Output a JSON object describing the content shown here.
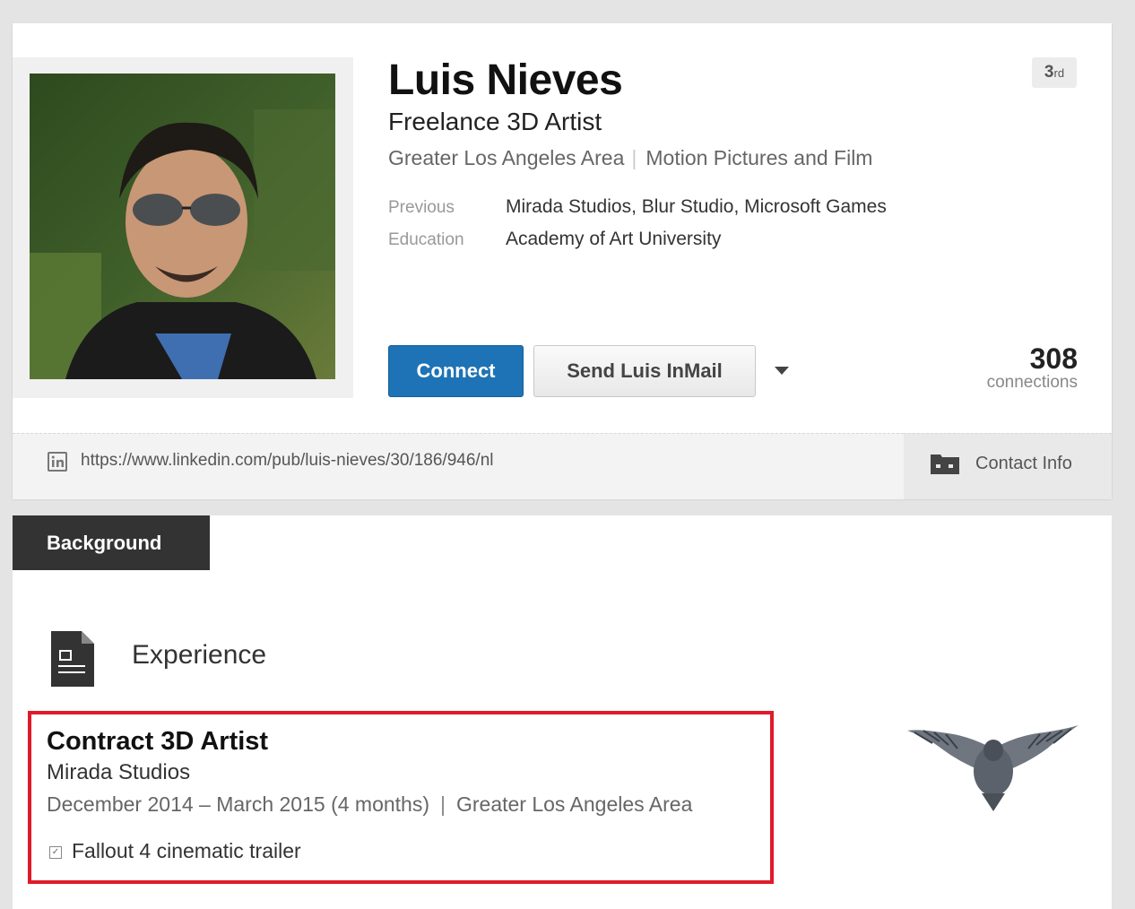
{
  "profile": {
    "name": "Luis Nieves",
    "headline": "Freelance 3D Artist",
    "location": "Greater Los Angeles Area",
    "industry": "Motion Pictures and Film",
    "degree": "3",
    "degree_suffix": "rd",
    "previous_label": "Previous",
    "previous_value": "Mirada Studios, Blur Studio, Microsoft Games",
    "education_label": "Education",
    "education_value": "Academy of Art University"
  },
  "actions": {
    "connect_label": "Connect",
    "inmail_label": "Send Luis InMail"
  },
  "connections": {
    "count": "308",
    "label": "connections"
  },
  "public_profile": {
    "url": "https://www.linkedin.com/pub/luis-nieves/30/186/946/nl",
    "contact_label": "Contact Info"
  },
  "background": {
    "tab_label": "Background",
    "section_title": "Experience"
  },
  "experience": [
    {
      "title": "Contract 3D Artist",
      "company": "Mirada Studios",
      "dates": "December 2014 – March 2015 (4 months)",
      "separator": "|",
      "location": "Greater Los Angeles Area",
      "description": "Fallout 4 cinematic trailer"
    }
  ],
  "colors": {
    "accent": "#1d73b5",
    "highlight_border": "#e01a2b",
    "tab_bg": "#333333"
  },
  "icons": [
    "linkedin-icon",
    "folder-icon",
    "document-icon",
    "checkbox-icon",
    "caret-down-icon",
    "company-logo-eagle"
  ]
}
